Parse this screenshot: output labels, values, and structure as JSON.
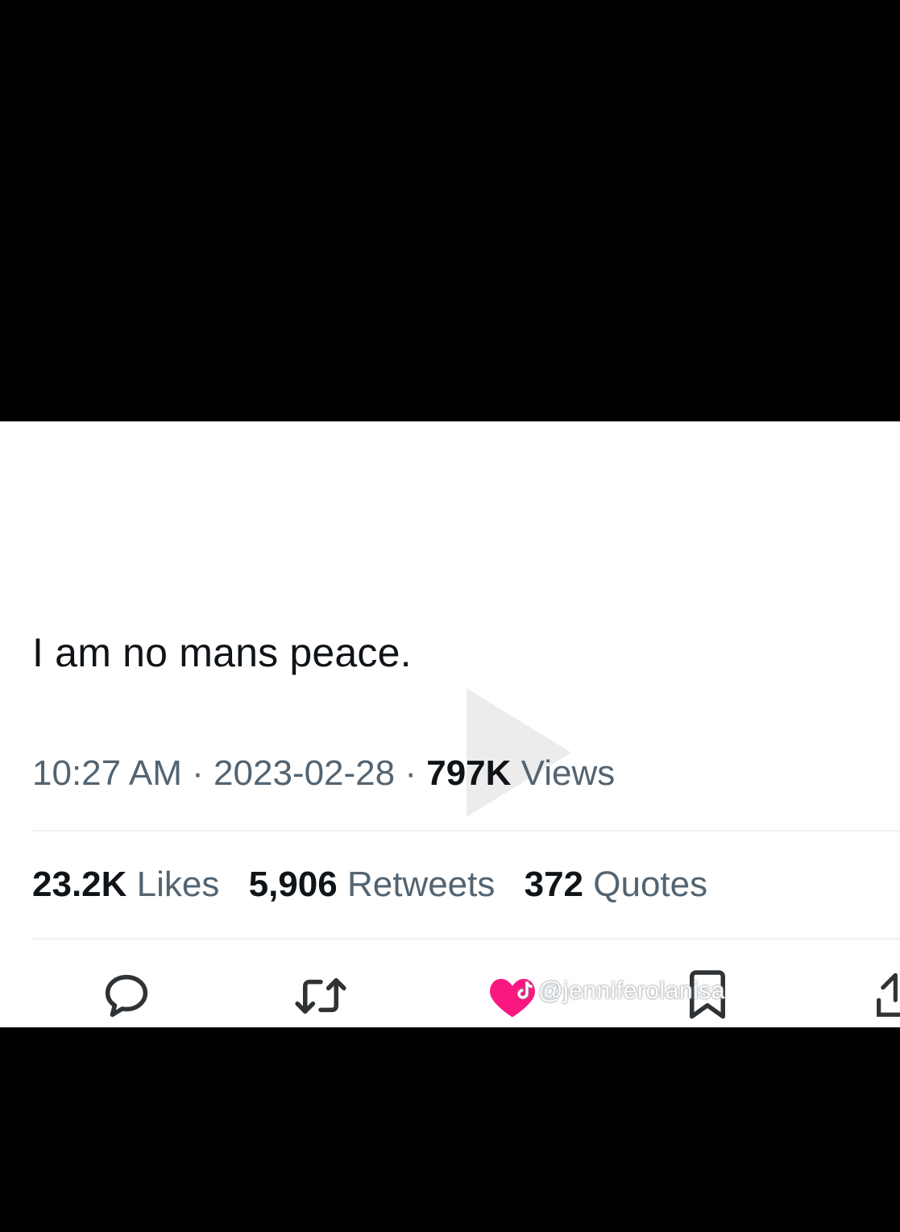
{
  "tweet": {
    "text": "I am no mans peace.",
    "time": "10:27 AM",
    "separator": "·",
    "date": "2023-02-28",
    "views_count": "797K",
    "views_label": "Views"
  },
  "stats": {
    "likes_count": "23.2K",
    "likes_label": "Likes",
    "retweets_count": "5,906",
    "retweets_label": "Retweets",
    "quotes_count": "372",
    "quotes_label": "Quotes"
  },
  "actions": {
    "icons": [
      "reply-icon",
      "retweet-icon",
      "like-icon",
      "bookmark-icon",
      "share-icon"
    ]
  },
  "watermark": {
    "text": "@jenniferolanisa"
  },
  "colors": {
    "text_primary": "#0f1419",
    "text_secondary": "#536471",
    "like_pink": "#f91880",
    "background": "#ffffff",
    "letterbox": "#000000"
  }
}
